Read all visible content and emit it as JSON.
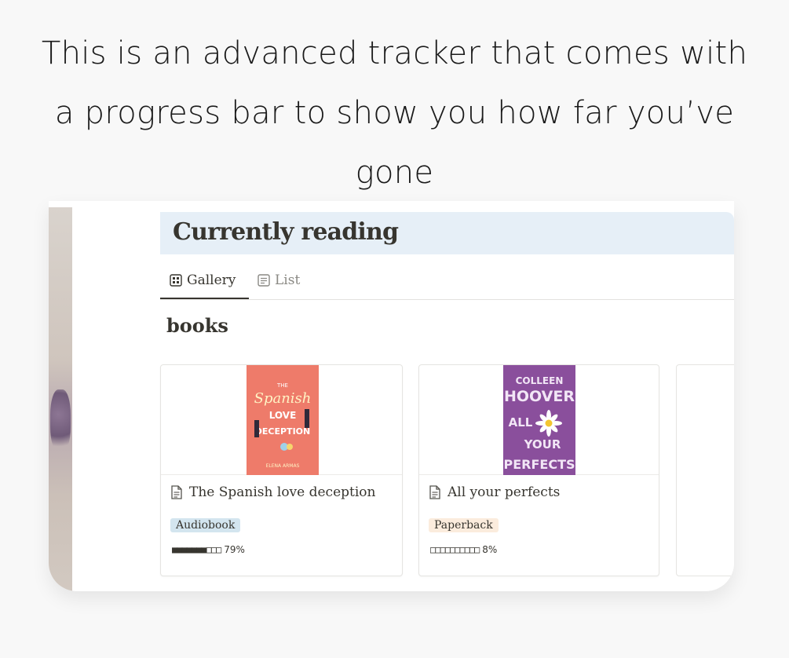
{
  "caption": {
    "line1": "This is an advanced tracker that comes with",
    "line2": "a progress bar to show you how far you’ve",
    "line3": "gone"
  },
  "page": {
    "title": "Currently reading",
    "tabs": [
      {
        "label": "Gallery",
        "icon": "gallery-icon",
        "active": true
      },
      {
        "label": "List",
        "icon": "list-icon",
        "active": false
      }
    ],
    "section_title": "books"
  },
  "cards": [
    {
      "title": "The Spanish love deception",
      "tag": "Audiobook",
      "tag_color": "#d3e5ef",
      "progress_bar": "■■■■■■■□□□",
      "progress_pct": "79%",
      "progress_value": 0.79,
      "cover": {
        "bg": "#ee7b6a",
        "line1": "THE",
        "line2": "Spanish",
        "line3": "LOVE",
        "line4": "DECEPTION",
        "author": "ELENA ARMAS"
      }
    },
    {
      "title": "All your perfects",
      "tag": "Paperback",
      "tag_color": "#fbecdd",
      "progress_bar": "□□□□□□□□□□",
      "progress_pct": "8%",
      "progress_value": 0.08,
      "cover": {
        "bg": "#8a4f9c",
        "line1": "COLLEEN",
        "line2": "HOOVER",
        "line3": "ALL",
        "line4": "YOUR",
        "line5": "PERFECTS"
      }
    }
  ],
  "colors": {
    "header_band": "#e6eff7",
    "text": "#37352f",
    "muted": "#8a8984"
  }
}
